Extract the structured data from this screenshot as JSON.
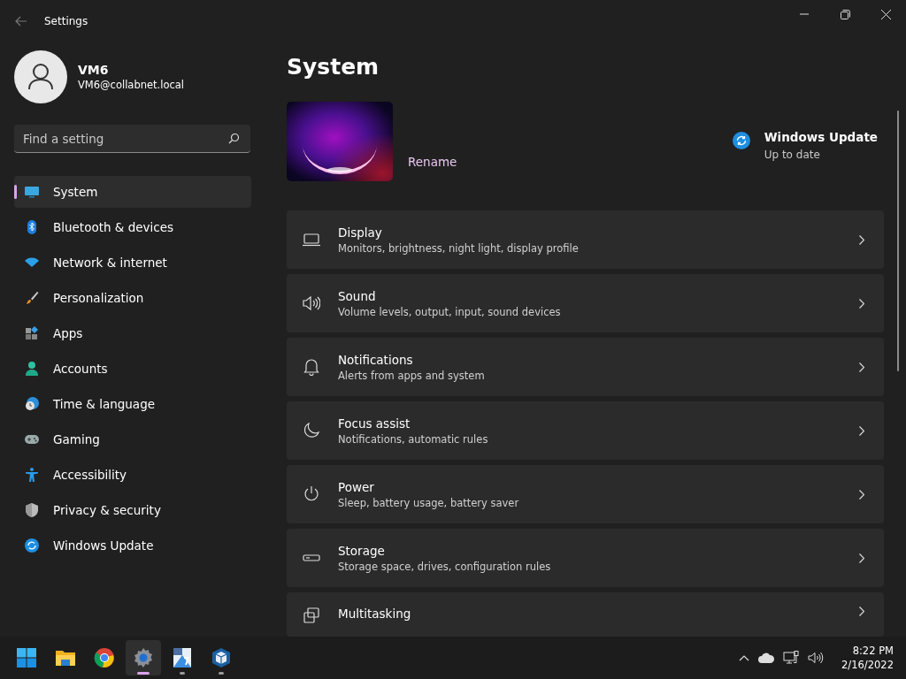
{
  "window": {
    "title": "Settings"
  },
  "user": {
    "name": "VM6",
    "email": "VM6@collabnet.local"
  },
  "search": {
    "placeholder": "Find a setting"
  },
  "nav": [
    {
      "label": "System",
      "selected": true
    },
    {
      "label": "Bluetooth & devices",
      "selected": false
    },
    {
      "label": "Network & internet",
      "selected": false
    },
    {
      "label": "Personalization",
      "selected": false
    },
    {
      "label": "Apps",
      "selected": false
    },
    {
      "label": "Accounts",
      "selected": false
    },
    {
      "label": "Time & language",
      "selected": false
    },
    {
      "label": "Gaming",
      "selected": false
    },
    {
      "label": "Accessibility",
      "selected": false
    },
    {
      "label": "Privacy & security",
      "selected": false
    },
    {
      "label": "Windows Update",
      "selected": false
    }
  ],
  "page": {
    "title": "System",
    "rename": "Rename",
    "update": {
      "title": "Windows Update",
      "status": "Up to date"
    }
  },
  "cards": [
    {
      "title": "Display",
      "description": "Monitors, brightness, night light, display profile"
    },
    {
      "title": "Sound",
      "description": "Volume levels, output, input, sound devices"
    },
    {
      "title": "Notifications",
      "description": "Alerts from apps and system"
    },
    {
      "title": "Focus assist",
      "description": "Notifications, automatic rules"
    },
    {
      "title": "Power",
      "description": "Sleep, battery usage, battery saver"
    },
    {
      "title": "Storage",
      "description": "Storage space, drives, configuration rules"
    },
    {
      "title": "Multitasking"
    }
  ],
  "taskbar": {
    "apps": [
      {
        "selected": false,
        "running": false
      },
      {
        "selected": false,
        "running": false
      },
      {
        "selected": false,
        "running": false
      },
      {
        "selected": true,
        "running": true
      },
      {
        "selected": false,
        "running": true
      },
      {
        "selected": false,
        "running": true
      }
    ],
    "time": "8:22 PM",
    "date": "2/16/2022"
  }
}
